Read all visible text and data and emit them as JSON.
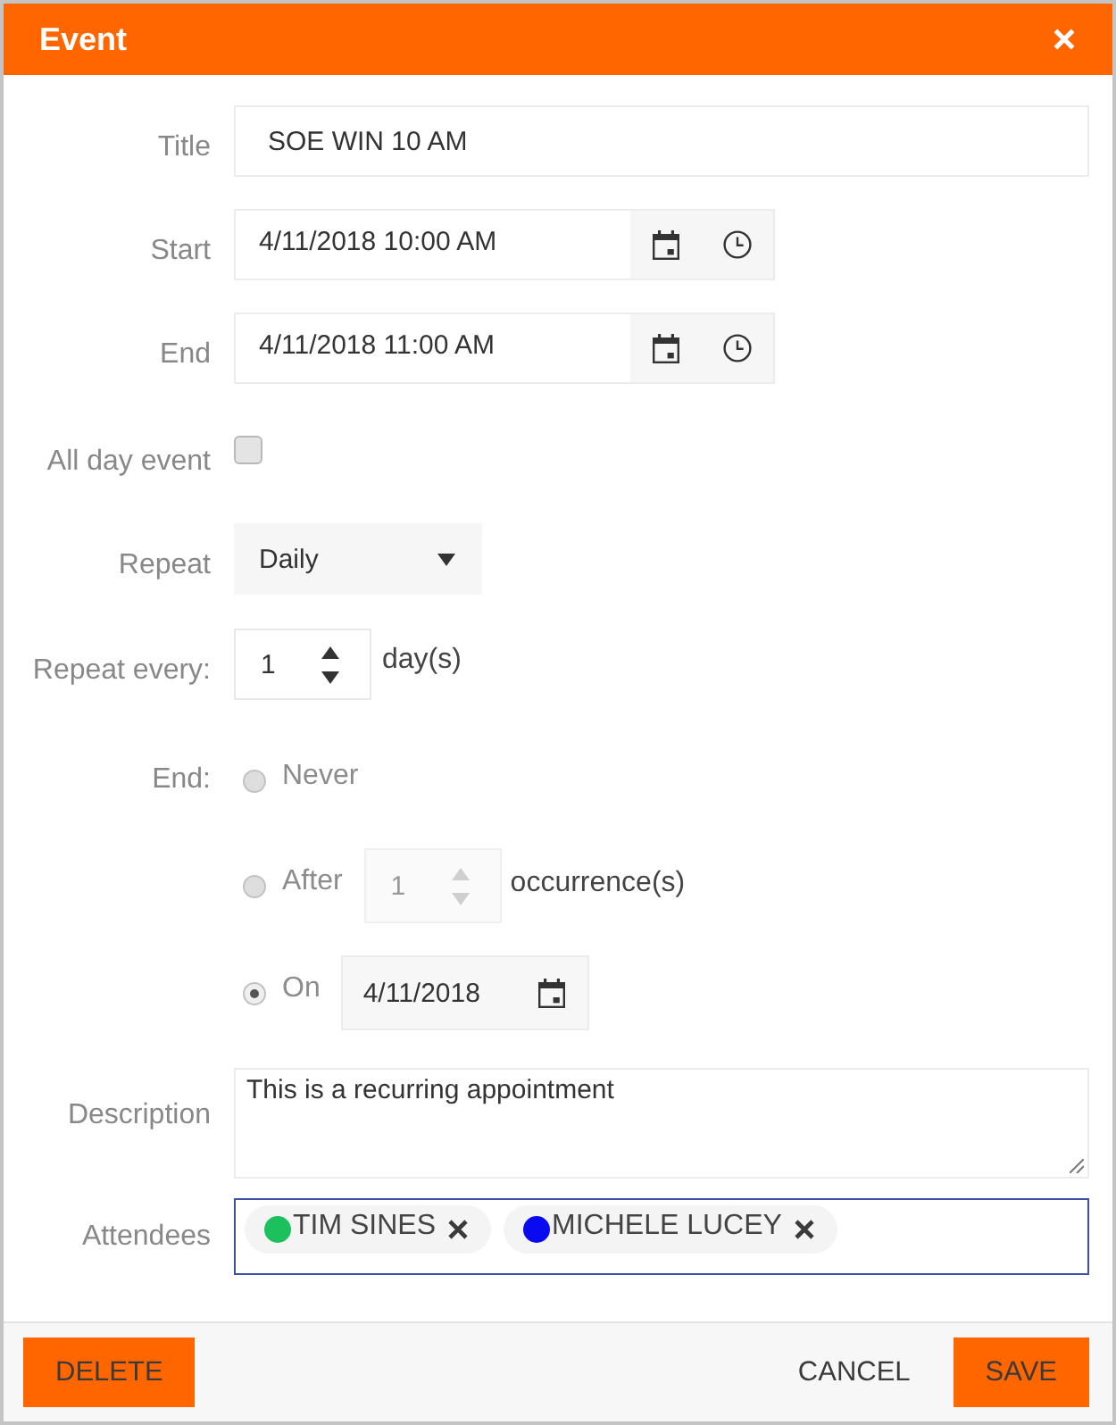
{
  "dialog": {
    "title": "Event"
  },
  "form": {
    "title": {
      "label": "Title",
      "value": "SOE WIN 10 AM"
    },
    "start": {
      "label": "Start",
      "value": "4/11/2018 10:00 AM"
    },
    "end": {
      "label": "End",
      "value": "4/11/2018 11:00 AM"
    },
    "all_day": {
      "label": "All day event",
      "checked": false
    },
    "repeat": {
      "label": "Repeat",
      "value": "Daily"
    },
    "repeat_every": {
      "label": "Repeat every:",
      "value": "1",
      "unit": "day(s)"
    },
    "end_options": {
      "label": "End:",
      "options": [
        {
          "kind": "plain",
          "label": "Never",
          "selected": false
        },
        {
          "kind": "count",
          "label": "After",
          "value": "1",
          "unit": "occurrence(s)",
          "disabled": true,
          "selected": false
        },
        {
          "kind": "date",
          "label": "On",
          "value": "4/11/2018",
          "selected": true
        }
      ]
    },
    "description": {
      "label": "Description",
      "value": "This is a recurring appointment"
    },
    "attendees": {
      "label": "Attendees",
      "focused": true,
      "items": [
        {
          "name": "TIM SINES",
          "color": "#1cc05c"
        },
        {
          "name": "MICHELE LUCEY",
          "color": "#0a0af0"
        }
      ]
    }
  },
  "footer": {
    "left_buttons": [
      {
        "label": "DELETE",
        "kind": "filled"
      }
    ],
    "right_buttons": [
      {
        "label": "CANCEL",
        "kind": "flat"
      },
      {
        "label": "SAVE",
        "kind": "filled"
      }
    ]
  }
}
